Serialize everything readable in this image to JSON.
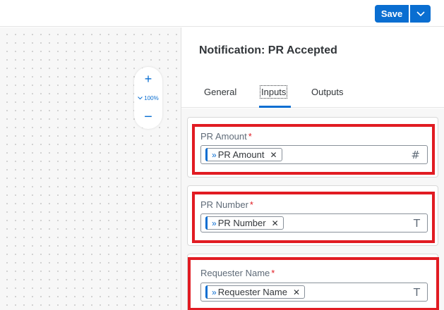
{
  "toolbar": {
    "save_label": "Save",
    "primary_color": "#0a6ed1"
  },
  "canvas": {
    "zoom_in_label": "+",
    "zoom_level": "100%",
    "zoom_out_label": "−"
  },
  "panel": {
    "title": "Notification: PR Accepted",
    "tabs": [
      {
        "label": "General",
        "active": false
      },
      {
        "label": "Inputs",
        "active": true
      },
      {
        "label": "Outputs",
        "active": false
      }
    ],
    "fields": [
      {
        "label": "PR Amount",
        "required_mark": "*",
        "token": "PR Amount",
        "type_icon": "#"
      },
      {
        "label": "PR Number",
        "required_mark": "*",
        "token": "PR Number",
        "type_icon": "T"
      },
      {
        "label": "Requester Name",
        "required_mark": "*",
        "token": "Requester Name",
        "type_icon": "T"
      }
    ]
  },
  "icons": {
    "save_menu": "chevron-down-icon",
    "zoom_level_chevron": "chevron-down-icon",
    "token": "context-variable-icon",
    "token_remove": "close-icon",
    "number_type": "hash-icon",
    "text_type": "text-type-icon"
  },
  "highlight_color": "#e11b22"
}
